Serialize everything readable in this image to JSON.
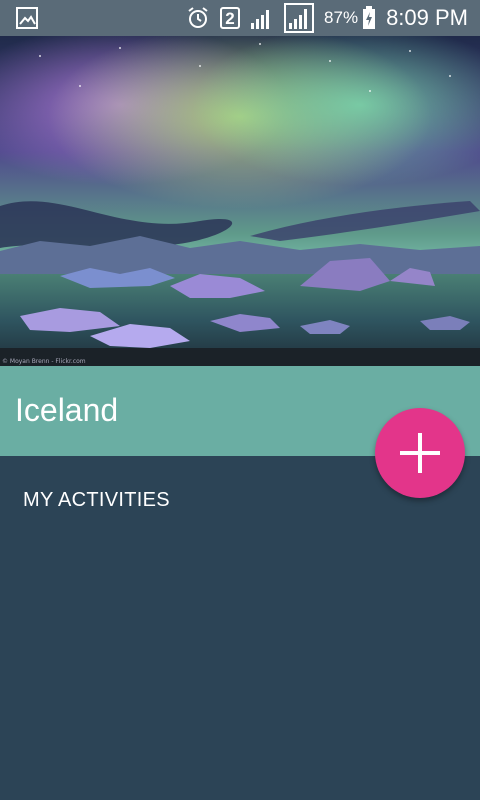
{
  "status_bar": {
    "sim_slot": "2",
    "battery_percent": "87%",
    "time": "8:09 PM",
    "icons": [
      "gallery-icon",
      "alarm-icon",
      "signal-icon",
      "signal-icon",
      "battery-charging-icon"
    ]
  },
  "hero": {
    "credit": "© Moyan Brenn - Flickr.com"
  },
  "trip": {
    "title": "Iceland"
  },
  "fab": {
    "icon": "plus-icon",
    "color": "#e3358a"
  },
  "activities": {
    "header": "MY ACTIVITIES"
  },
  "colors": {
    "title_band": "#6aaea3",
    "background": "#2c4456",
    "status_bar": "#5a6b78"
  }
}
